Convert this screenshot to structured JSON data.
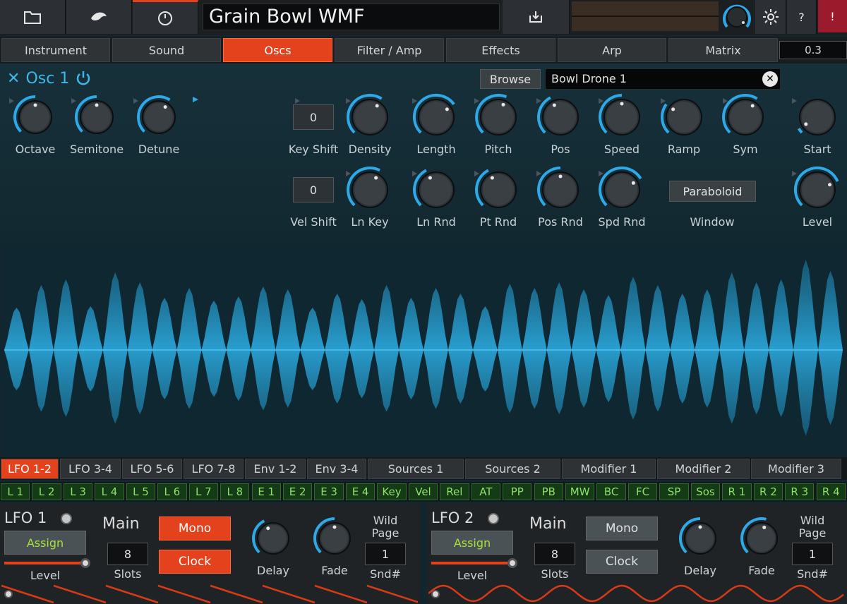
{
  "header": {
    "preset_name": "Grain Bowl WMF",
    "help_label": "?",
    "alert_label": "!"
  },
  "tabs": [
    "Instrument",
    "Sound",
    "Oscs",
    "Filter / Amp",
    "Effects",
    "Arp",
    "Matrix"
  ],
  "active_tab": "Oscs",
  "tab_value": "0.3",
  "osc": {
    "title": "Osc 1",
    "browse_label": "Browse",
    "sample_name": "Bowl Drone 1",
    "knobs_row1_left": [
      {
        "label": "Octave",
        "value": 0.5
      },
      {
        "label": "Semitone",
        "value": 0.5
      },
      {
        "label": "Detune",
        "value": 0.62
      }
    ],
    "key_shift": {
      "label": "Key Shift",
      "value": "0"
    },
    "vel_shift": {
      "label": "Vel Shift",
      "value": "0"
    },
    "knobs_row1": [
      {
        "label": "Density",
        "value": 0.62
      },
      {
        "label": "Length",
        "value": 0.7
      },
      {
        "label": "Pitch",
        "value": 0.58
      },
      {
        "label": "Pos",
        "value": 0.4
      },
      {
        "label": "Speed",
        "value": 0.5
      },
      {
        "label": "Ramp",
        "value": 0.3
      },
      {
        "label": "Sym",
        "value": 0.62
      },
      {
        "label": "Start",
        "value": 0.05
      }
    ],
    "knobs_row2": [
      {
        "label": "Ln Key",
        "value": 0.6
      },
      {
        "label": "Ln Rnd",
        "value": 0.4
      },
      {
        "label": "Pt Rnd",
        "value": 0.4
      },
      {
        "label": "Pos Rnd",
        "value": 0.5
      },
      {
        "label": "Spd Rnd",
        "value": 0.72
      }
    ],
    "window": {
      "label": "Window",
      "value": "Paraboloid"
    },
    "level": {
      "label": "Level",
      "value": 0.75
    }
  },
  "mod_tabs": [
    "LFO 1-2",
    "LFO 3-4",
    "LFO 5-6",
    "LFO 7-8",
    "Env 1-2",
    "Env 3-4",
    "Sources 1",
    "Sources 2",
    "Modifier 1",
    "Modifier 2",
    "Modifier 3"
  ],
  "active_mod_tab": "LFO 1-2",
  "sources": [
    "L 1",
    "L 2",
    "L 3",
    "L 4",
    "L 5",
    "L 6",
    "L 7",
    "L 8",
    "E 1",
    "E 2",
    "E 3",
    "E 4",
    "Key",
    "Vel",
    "Rel",
    "AT",
    "PP",
    "PB",
    "MW",
    "BC",
    "FC",
    "SP",
    "Sos",
    "R 1",
    "R 2",
    "R 3",
    "R 4"
  ],
  "lfos": [
    {
      "name": "LFO 1",
      "assign": "Assign",
      "level_label": "Level",
      "main_label": "Main",
      "slots_value": "8",
      "slots_label": "Slots",
      "mono": "Mono",
      "clock": "Clock",
      "mono_on": true,
      "clock_on": true,
      "delay_label": "Delay",
      "fade_label": "Fade",
      "wild_label": "Wild",
      "page_label": "Page",
      "snd_value": "1",
      "snd_label": "Snd#",
      "level": 0.97,
      "delay": 0.4,
      "fade": 0.5
    },
    {
      "name": "LFO 2",
      "assign": "Assign",
      "level_label": "Level",
      "main_label": "Main",
      "slots_value": "8",
      "slots_label": "Slots",
      "mono": "Mono",
      "clock": "Clock",
      "mono_on": false,
      "clock_on": false,
      "delay_label": "Delay",
      "fade_label": "Fade",
      "wild_label": "Wild",
      "page_label": "Page",
      "snd_value": "1",
      "snd_label": "Snd#",
      "level": 0.97,
      "delay": 0.5,
      "fade": 0.55
    }
  ],
  "colors": {
    "accent": "#e4421c",
    "arc": "#2fa8e8",
    "source_green": "#8ee26a"
  }
}
